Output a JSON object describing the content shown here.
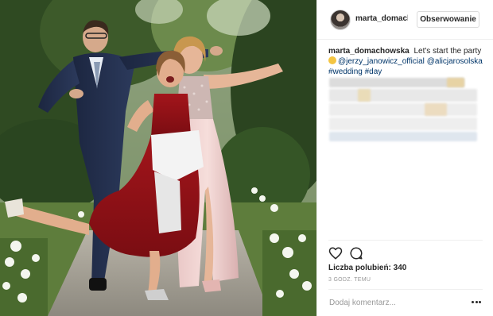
{
  "post": {
    "username": "marta_domachowska",
    "follow_label": "Obserwowanie",
    "caption": {
      "author": "marta_domachowska",
      "text": "Let's start the party",
      "mention_1": "@jerzy_janowicz_official",
      "mention_2": "@alicjarosolska",
      "hashtag_1": "#wedding",
      "hashtag_2": "#day"
    },
    "likes_text": "Liczba polubień: 340",
    "timestamp": "3 GODZ. TEMU",
    "comment_placeholder": "Dodaj komentarz..."
  },
  "icons": {
    "like": "heart-icon",
    "comment": "comment-bubble-icon",
    "more": "more-dots-icon",
    "emoji": "emoji-icon"
  },
  "colors": {
    "link": "#003569",
    "text": "#262626",
    "muted": "#999999",
    "border": "#dbdbdb",
    "divider": "#efefef"
  }
}
